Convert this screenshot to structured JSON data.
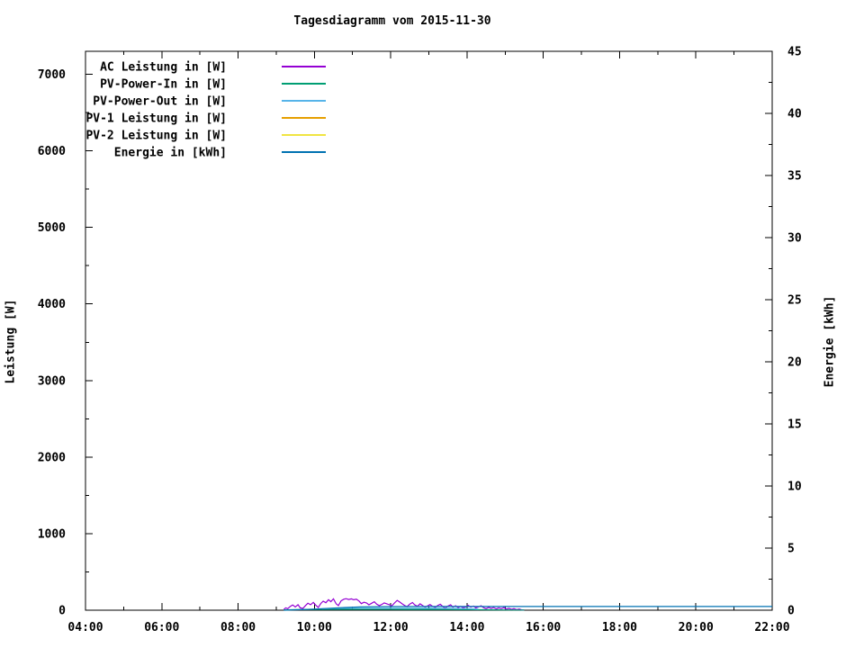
{
  "title": "Tagesdiagramm vom 2015-11-30",
  "chart_data": {
    "type": "line",
    "title": "Tagesdiagramm vom 2015-11-30",
    "background": "#ffffff",
    "axis_color": "#000000",
    "grid": false,
    "legend_position": "top-left",
    "x_axis": {
      "range_hours": [
        4,
        22
      ],
      "major_tick_hours": [
        4,
        6,
        8,
        10,
        12,
        14,
        16,
        18,
        20,
        22
      ],
      "major_tick_labels": [
        "04:00",
        "06:00",
        "08:00",
        "10:00",
        "12:00",
        "14:00",
        "16:00",
        "18:00",
        "20:00",
        "22:00"
      ],
      "minor_tick_step_hours": 1
    },
    "y_axis_left": {
      "label": "Leistung [W]",
      "range": [
        0,
        7300
      ],
      "major_ticks": [
        0,
        1000,
        2000,
        3000,
        4000,
        5000,
        6000,
        7000
      ],
      "minor_tick_step": 500
    },
    "y_axis_right": {
      "label": "Energie [kWh]",
      "range": [
        0,
        45
      ],
      "major_ticks": [
        0,
        5,
        10,
        15,
        20,
        25,
        30,
        35,
        40,
        45
      ],
      "minor_tick_step": 2.5
    },
    "legend": {
      "entries": [
        {
          "label": "AC Leistung in [W]",
          "color": "#9400d3"
        },
        {
          "label": "PV-Power-In in [W]",
          "color": "#009e73"
        },
        {
          "label": "PV-Power-Out in [W]",
          "color": "#56b4e9"
        },
        {
          "label": "PV-1 Leistung in [W]",
          "color": "#e69f00"
        },
        {
          "label": "PV-2 Leistung in [W]",
          "color": "#f0e442"
        },
        {
          "label": "Energie in [kWh]",
          "color": "#0072b2"
        }
      ]
    },
    "series": [
      {
        "name": "AC Leistung in [W]",
        "color": "#9400d3",
        "axis": "left",
        "points": [
          [
            9.2,
            12
          ],
          [
            9.25,
            30
          ],
          [
            9.3,
            20
          ],
          [
            9.37,
            50
          ],
          [
            9.43,
            68
          ],
          [
            9.5,
            42
          ],
          [
            9.57,
            72
          ],
          [
            9.63,
            30
          ],
          [
            9.7,
            24
          ],
          [
            9.77,
            62
          ],
          [
            9.83,
            92
          ],
          [
            9.9,
            72
          ],
          [
            9.97,
            102
          ],
          [
            10.03,
            68
          ],
          [
            10.1,
            36
          ],
          [
            10.17,
            88
          ],
          [
            10.23,
            118
          ],
          [
            10.3,
            98
          ],
          [
            10.37,
            138
          ],
          [
            10.43,
            112
          ],
          [
            10.5,
            148
          ],
          [
            10.57,
            84
          ],
          [
            10.63,
            60
          ],
          [
            10.7,
            122
          ],
          [
            10.77,
            143
          ],
          [
            10.83,
            150
          ],
          [
            10.9,
            140
          ],
          [
            10.97,
            148
          ],
          [
            11.03,
            136
          ],
          [
            11.1,
            144
          ],
          [
            11.17,
            120
          ],
          [
            11.23,
            86
          ],
          [
            11.3,
            104
          ],
          [
            11.37,
            94
          ],
          [
            11.43,
            70
          ],
          [
            11.5,
            90
          ],
          [
            11.57,
            110
          ],
          [
            11.63,
            80
          ],
          [
            11.7,
            60
          ],
          [
            11.77,
            76
          ],
          [
            11.83,
            95
          ],
          [
            11.9,
            84
          ],
          [
            11.97,
            70
          ],
          [
            12.03,
            56
          ],
          [
            12.1,
            94
          ],
          [
            12.17,
            128
          ],
          [
            12.23,
            108
          ],
          [
            12.3,
            84
          ],
          [
            12.37,
            60
          ],
          [
            12.43,
            46
          ],
          [
            12.5,
            80
          ],
          [
            12.57,
            100
          ],
          [
            12.63,
            70
          ],
          [
            12.7,
            50
          ],
          [
            12.77,
            84
          ],
          [
            12.83,
            64
          ],
          [
            12.9,
            40
          ],
          [
            12.97,
            56
          ],
          [
            13.03,
            74
          ],
          [
            13.1,
            50
          ],
          [
            13.17,
            36
          ],
          [
            13.23,
            60
          ],
          [
            13.3,
            78
          ],
          [
            13.37,
            46
          ],
          [
            13.43,
            26
          ],
          [
            13.5,
            54
          ],
          [
            13.57,
            70
          ],
          [
            13.63,
            40
          ],
          [
            13.7,
            58
          ],
          [
            13.77,
            34
          ],
          [
            13.83,
            50
          ],
          [
            13.9,
            30
          ],
          [
            13.97,
            44
          ],
          [
            14.03,
            64
          ],
          [
            14.1,
            40
          ],
          [
            14.17,
            54
          ],
          [
            14.23,
            30
          ],
          [
            14.3,
            44
          ],
          [
            14.37,
            58
          ],
          [
            14.43,
            34
          ],
          [
            14.5,
            20
          ],
          [
            14.57,
            38
          ],
          [
            14.63,
            24
          ],
          [
            14.7,
            34
          ],
          [
            14.77,
            16
          ],
          [
            14.83,
            30
          ],
          [
            14.9,
            20
          ],
          [
            14.97,
            34
          ],
          [
            15.03,
            14
          ],
          [
            15.1,
            24
          ],
          [
            15.17,
            10
          ],
          [
            15.23,
            20
          ],
          [
            15.3,
            8
          ],
          [
            15.37,
            14
          ],
          [
            15.43,
            5
          ],
          [
            15.5,
            2
          ]
        ]
      },
      {
        "name": "PV-Power-In in [W]",
        "color": "#009e73",
        "axis": "left",
        "points": [
          [
            9.2,
            3
          ],
          [
            9.5,
            8
          ],
          [
            10,
            10
          ],
          [
            10.5,
            12
          ],
          [
            11,
            12
          ],
          [
            11.5,
            12
          ],
          [
            12,
            12
          ],
          [
            12.5,
            11
          ],
          [
            13,
            10
          ],
          [
            13.5,
            9
          ],
          [
            14,
            8
          ],
          [
            14.5,
            6
          ],
          [
            15,
            4
          ],
          [
            15.5,
            2
          ]
        ]
      },
      {
        "name": "PV-Power-Out in [W]",
        "color": "#56b4e9",
        "axis": "left",
        "points": [
          [
            10.2,
            18
          ],
          [
            10.5,
            24
          ],
          [
            11,
            26
          ],
          [
            11.5,
            26
          ],
          [
            12,
            26
          ],
          [
            12.5,
            26
          ],
          [
            13,
            25
          ],
          [
            13.5,
            24
          ],
          [
            14,
            20
          ],
          [
            14.3,
            14
          ]
        ]
      },
      {
        "name": "PV-1 Leistung in [W]",
        "color": "#e69f00",
        "axis": "left",
        "points": []
      },
      {
        "name": "PV-2 Leistung in [W]",
        "color": "#f0e442",
        "axis": "left",
        "points": []
      },
      {
        "name": "Energie in [kWh]",
        "color": "#0072b2",
        "axis": "right",
        "points": [
          [
            9.2,
            0
          ],
          [
            9.7,
            0.05
          ],
          [
            10.2,
            0.12
          ],
          [
            10.7,
            0.2
          ],
          [
            11.2,
            0.26
          ],
          [
            12,
            0.29
          ],
          [
            13,
            0.3
          ],
          [
            14,
            0.3
          ],
          [
            16,
            0.3
          ],
          [
            18,
            0.3
          ],
          [
            20,
            0.3
          ],
          [
            22,
            0.3
          ]
        ]
      }
    ]
  }
}
